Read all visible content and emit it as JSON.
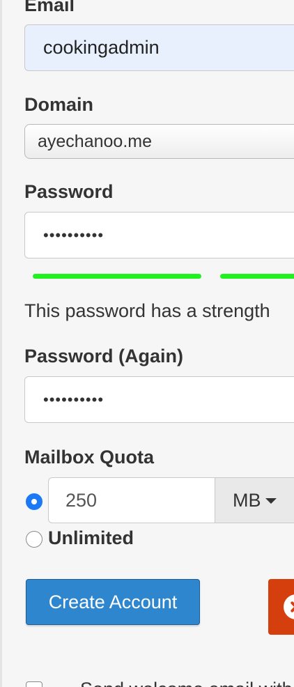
{
  "form": {
    "email_label": "Email",
    "email_value": "cookingadmin",
    "domain_label": "Domain",
    "domain_value": "ayechanoo.me",
    "password_label": "Password",
    "password_value": "••••••••••",
    "password_strength_text": "This password has a strength",
    "password_again_label": "Password (Again)",
    "password_again_value": "••••••••••",
    "quota_label": "Mailbox Quota",
    "quota_value": "250",
    "quota_unit": "MB",
    "quota_mode_selected": "limited",
    "unlimited_label": "Unlimited",
    "create_button_label": "Create Account",
    "welcome_email_label": "Send welcome email with"
  },
  "colors": {
    "strength_bar": "#1ff21f",
    "primary_button": "#2e86cf",
    "cancel_button": "#d43f0d",
    "radio_selected": "#1b79f5",
    "email_autofill_bg": "#e8f0fe"
  },
  "icons": {
    "cancel": "close-circle-icon",
    "unit_dropdown": "caret-down-icon"
  }
}
